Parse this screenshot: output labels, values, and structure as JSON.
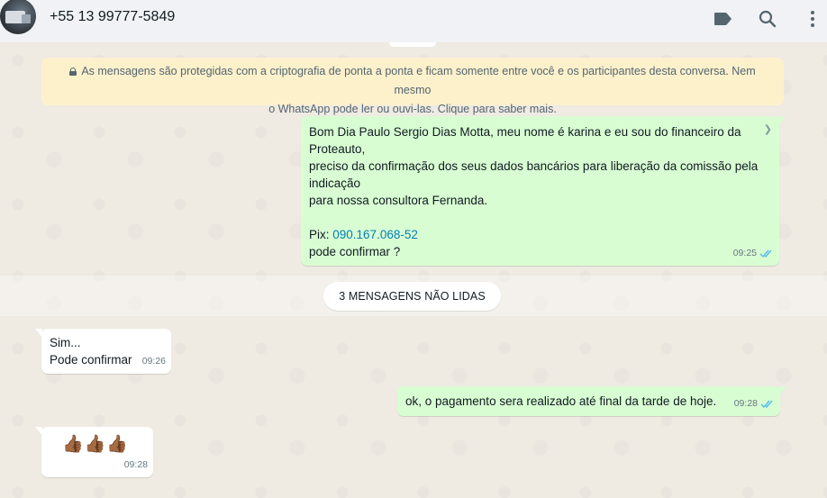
{
  "header": {
    "contact_name": "+55 13 99777-5849",
    "icons": [
      "label-icon",
      "search-icon",
      "menu-icon"
    ]
  },
  "chat": {
    "encryption_notice_line1": "As mensagens são protegidas com a criptografia de ponta a ponta e ficam somente entre você e os participantes desta conversa. Nem mesmo",
    "encryption_notice_line2": "o WhatsApp pode ler ou ouvi-las. Clique para saber mais.",
    "unread_label": "3 MENSAGENS NÃO LIDAS",
    "messages": [
      {
        "direction": "outgoing",
        "lines": [
          "Bom Dia Paulo Sergio Dias Motta, meu nome é karina  e eu sou do financeiro da",
          "Proteauto,",
          "preciso da confirmação dos seus dados bancários para liberação da comissão pela",
          "indicação",
          "para nossa consultora Fernanda."
        ],
        "pix_label": "Pix: ",
        "pix_value": "090.167.068-52",
        "last_line": "pode confirmar ?",
        "time": "09:25"
      },
      {
        "direction": "incoming",
        "lines": [
          "Sim...",
          "Pode confirmar"
        ],
        "time": "09:26"
      },
      {
        "direction": "outgoing",
        "text": "ok, o pagamento sera realizado até final da tarde de hoje.",
        "time": "09:28"
      },
      {
        "direction": "incoming",
        "text": "👍🏾👍🏾👍🏾",
        "time": "09:28"
      }
    ]
  },
  "colors": {
    "outgoing_bubble": "#d9fdd3",
    "incoming_bubble": "#ffffff",
    "encryption_bg": "#fdf1cc",
    "read_ticks": "#53bdeb",
    "link": "#027eb5"
  }
}
